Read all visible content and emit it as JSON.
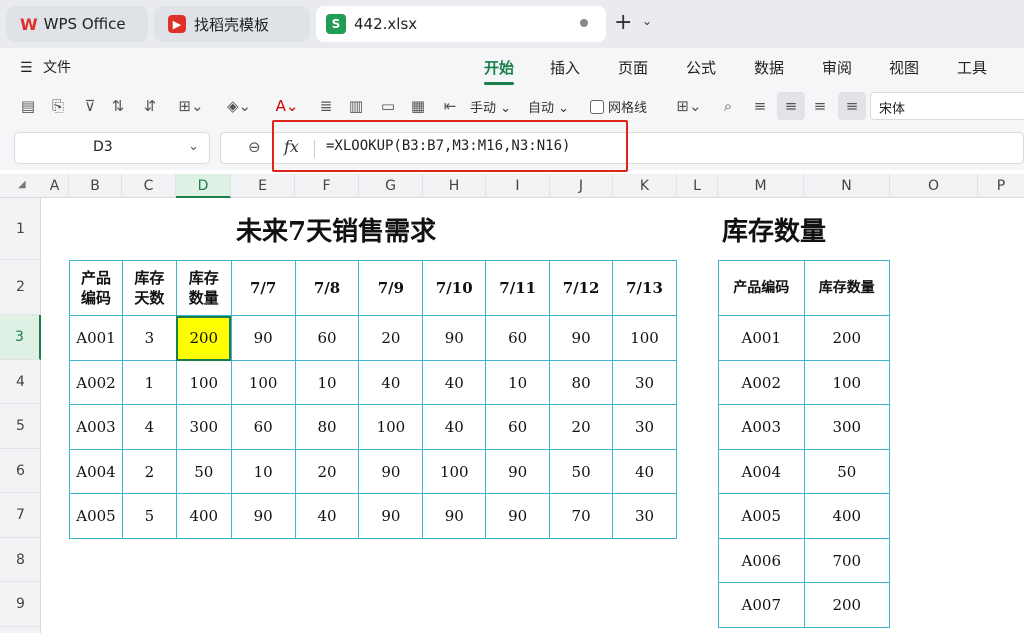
{
  "tabs": [
    {
      "label": "WPS Office"
    },
    {
      "label": "找稻壳模板"
    },
    {
      "label": "442.xlsx"
    }
  ],
  "logos": {
    "wps": "W",
    "doc": "▶",
    "sheet": "S"
  },
  "menu": {
    "file": "文件",
    "tabs": [
      "开始",
      "插入",
      "页面",
      "公式",
      "数据",
      "审阅",
      "视图",
      "工具"
    ]
  },
  "toolbar": {
    "manual": "手动",
    "auto": "自动",
    "gridlines": "网格线",
    "font": "宋体"
  },
  "formula_bar": {
    "cell_ref": "D3",
    "fx": "fx",
    "formula": "=XLOOKUP(B3:B7,M3:M16,N3:N16)"
  },
  "columns": [
    "A",
    "B",
    "C",
    "D",
    "E",
    "F",
    "G",
    "H",
    "I",
    "J",
    "K",
    "L",
    "M",
    "N",
    "O",
    "P"
  ],
  "rows": [
    "1",
    "2",
    "3",
    "4",
    "5",
    "6",
    "7",
    "8",
    "9"
  ],
  "sheet": {
    "title_main": "未来7天销售需求",
    "title_stock": "库存数量",
    "demand_headers": [
      [
        "产品",
        "编码"
      ],
      [
        "库存",
        "天数"
      ],
      [
        "库存",
        "数量"
      ],
      "7/7",
      "7/8",
      "7/9",
      "7/10",
      "7/11",
      "7/12",
      "7/13"
    ],
    "demand_rows": [
      [
        "A001",
        "3",
        "200",
        "90",
        "60",
        "20",
        "90",
        "60",
        "90",
        "100"
      ],
      [
        "A002",
        "1",
        "100",
        "100",
        "10",
        "40",
        "40",
        "10",
        "80",
        "30"
      ],
      [
        "A003",
        "4",
        "300",
        "60",
        "80",
        "100",
        "40",
        "60",
        "20",
        "30"
      ],
      [
        "A004",
        "2",
        "50",
        "10",
        "20",
        "90",
        "100",
        "90",
        "50",
        "40"
      ],
      [
        "A005",
        "5",
        "400",
        "90",
        "40",
        "90",
        "90",
        "90",
        "70",
        "30"
      ]
    ],
    "stock_headers": [
      "产品编码",
      "库存数量"
    ],
    "stock_rows": [
      [
        "A001",
        "200"
      ],
      [
        "A002",
        "100"
      ],
      [
        "A003",
        "300"
      ],
      [
        "A004",
        "50"
      ],
      [
        "A005",
        "400"
      ],
      [
        "A006",
        "700"
      ],
      [
        "A007",
        "200"
      ]
    ]
  },
  "colors": {
    "accent": "#1a7f4b",
    "highlight": "#ffff00",
    "grid": "#3fb4cf",
    "annotation": "#e0241b"
  }
}
